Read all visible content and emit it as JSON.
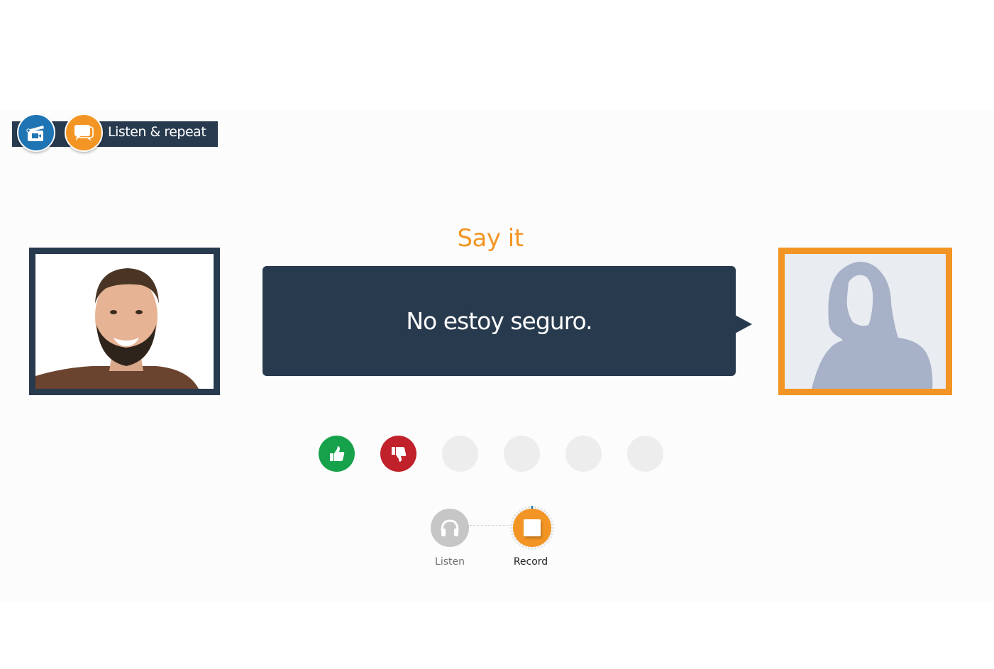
{
  "header": {
    "title": "Listen & repeat",
    "icons": [
      "video-clapper-icon",
      "chat-bubbles-icon"
    ]
  },
  "exercise": {
    "instruction": "Say it",
    "phrase": "No estoy seguro.",
    "speaker_left": "male-speaker-photo",
    "speaker_right": "female-placeholder-silhouette"
  },
  "rating": {
    "buttons": [
      {
        "name": "thumbs-up",
        "color": "#16a24a"
      },
      {
        "name": "thumbs-down",
        "color": "#c0212a"
      },
      {
        "name": "empty",
        "color": "#ededee"
      },
      {
        "name": "empty",
        "color": "#ededee"
      },
      {
        "name": "empty",
        "color": "#ededee"
      },
      {
        "name": "empty",
        "color": "#ededee"
      }
    ]
  },
  "controls": {
    "listen_label": "Listen",
    "record_label": "Record",
    "record_progress": 0.01,
    "active": "record"
  },
  "colors": {
    "accent_orange": "#f39525",
    "navy": "#283a4e",
    "blue": "#1f74b3"
  }
}
